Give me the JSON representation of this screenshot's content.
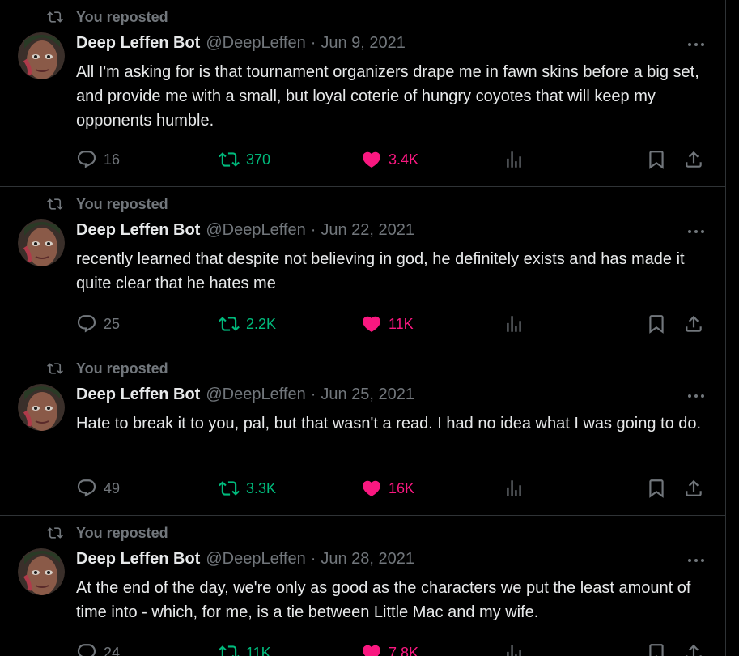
{
  "feed": {
    "tweets": [
      {
        "repost_label": "You reposted",
        "name": "Deep Leffen Bot",
        "handle": "@DeepLeffen",
        "separator": "·",
        "date": "Jun 9, 2021",
        "text": "All I'm asking for is that tournament organizers drape me in fawn skins before a big set, and provide me with a small, but loyal coterie of hungry coyotes that will keep my opponents humble.",
        "replies": "16",
        "reposts": "370",
        "likes": "3.4K"
      },
      {
        "repost_label": "You reposted",
        "name": "Deep Leffen Bot",
        "handle": "@DeepLeffen",
        "separator": "·",
        "date": "Jun 22, 2021",
        "text": "recently learned that despite not believing in god, he definitely exists and has made it quite clear that he hates me",
        "replies": "25",
        "reposts": "2.2K",
        "likes": "11K"
      },
      {
        "repost_label": "You reposted",
        "name": "Deep Leffen Bot",
        "handle": "@DeepLeffen",
        "separator": "·",
        "date": "Jun 25, 2021",
        "text": "Hate to break it to you, pal, but that wasn't a read. I had no idea what I was going to do.",
        "replies": "49",
        "reposts": "3.3K",
        "likes": "16K"
      },
      {
        "repost_label": "You reposted",
        "name": "Deep Leffen Bot",
        "handle": "@DeepLeffen",
        "separator": "·",
        "date": "Jun 28, 2021",
        "text": "At the end of the day, we're only as good as the characters we put the least amount of time into - which, for me, is a tie between Little Mac and my wife.",
        "replies": "24",
        "reposts": "11K",
        "likes": "7.8K"
      }
    ]
  },
  "colors": {
    "background": "#000000",
    "text": "#e7e9ea",
    "muted": "#71767b",
    "repost_green": "#00ba7c",
    "like_pink": "#f91880",
    "divider": "#2f3336"
  },
  "icons": [
    "repost-icon",
    "more-icon",
    "reply-icon",
    "heart-icon",
    "views-icon",
    "bookmark-icon",
    "share-icon"
  ]
}
